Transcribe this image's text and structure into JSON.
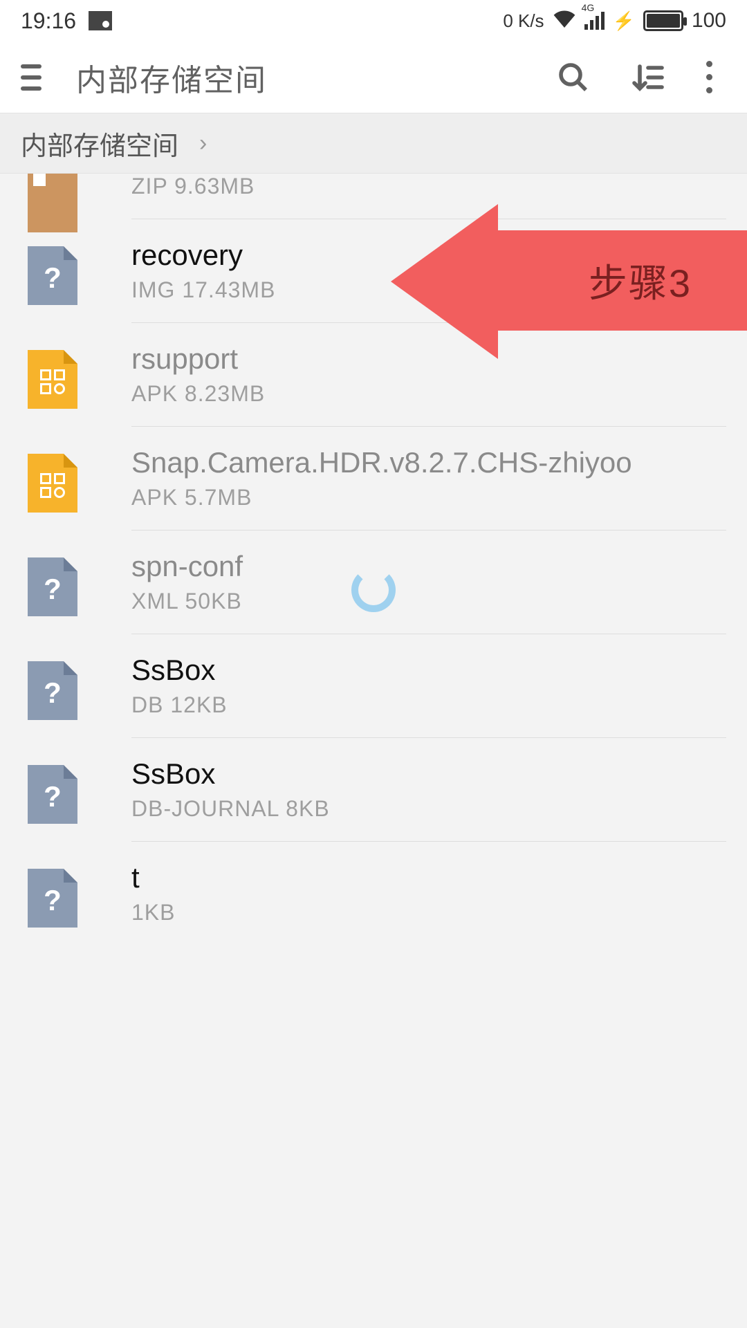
{
  "status": {
    "time": "19:16",
    "net_speed": "0 K/s",
    "cell_label": "4G",
    "battery_pct": "100"
  },
  "appbar": {
    "title": "内部存储空间"
  },
  "breadcrumb": {
    "root": "内部存储空间"
  },
  "files": [
    {
      "name_partial": "",
      "meta": "ZIP 9.63MB",
      "icon": "zip",
      "active": false
    },
    {
      "name": "recovery",
      "meta": "IMG 17.43MB",
      "icon": "unknown",
      "active": true
    },
    {
      "name": "rsupport",
      "meta": "APK 8.23MB",
      "icon": "apk",
      "active": false
    },
    {
      "name": "Snap.Camera.HDR.v8.2.7.CHS-zhiyoo",
      "meta": "APK 5.7MB",
      "icon": "apk",
      "active": false
    },
    {
      "name": "spn-conf",
      "meta": "XML 50KB",
      "icon": "unknown",
      "active": false
    },
    {
      "name": "SsBox",
      "meta": "DB 12KB",
      "icon": "unknown",
      "active": true
    },
    {
      "name": "SsBox",
      "meta": "DB-JOURNAL 8KB",
      "icon": "unknown",
      "active": true
    },
    {
      "name": "t",
      "meta": " 1KB",
      "icon": "unknown",
      "active": true
    }
  ],
  "annotation": {
    "label": "步骤3"
  }
}
